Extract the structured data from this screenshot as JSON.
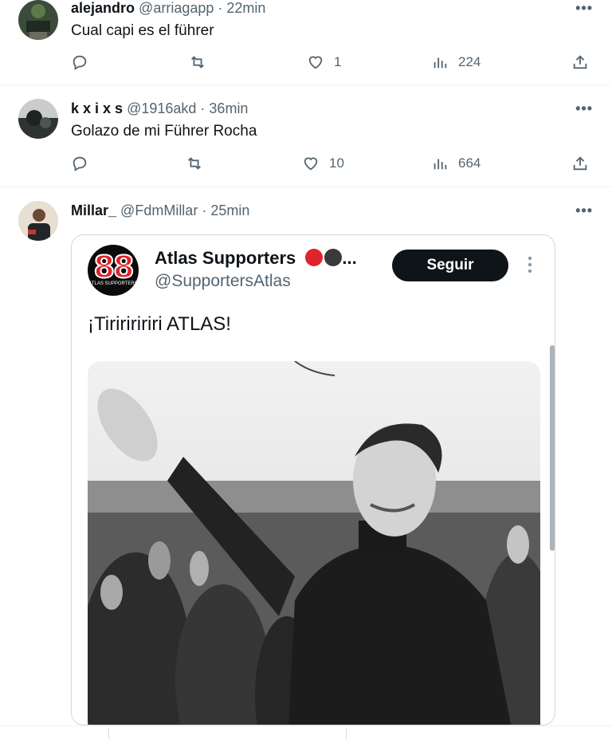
{
  "tweets": [
    {
      "name": "alejandro",
      "handle": "@arriagapp",
      "sep": " · ",
      "time": "22min",
      "text": "Cual capi es el führer",
      "likes": "1",
      "views": "224"
    },
    {
      "name": "k x i x s",
      "handle": "@1916akd",
      "sep": " · ",
      "time": "36min",
      "text": "Golazo de mi Führer Rocha",
      "likes": "10",
      "views": "664"
    },
    {
      "name": "Millar_",
      "handle": "@FdmMillar",
      "sep": " · ",
      "time": "25min"
    }
  ],
  "more_label": "•••",
  "embed": {
    "logo_number": "88",
    "logo_sub": "ATLAS SUPPORTERS",
    "name": "Atlas Supporters",
    "ellipsis": "...",
    "dot_colors": [
      "#e0242b",
      "#3a3a3a"
    ],
    "handle": "@SupportersAtlas",
    "follow_label": "Seguir",
    "kebab": "⋮",
    "text": "¡Tiririririri ATLAS!"
  },
  "icons": {
    "reply": "reply-icon",
    "retweet": "retweet-icon",
    "like": "heart-icon",
    "views": "views-icon",
    "share": "share-icon"
  },
  "colors": {
    "text": "#0f1419",
    "muted": "#536471",
    "border": "#eff3f4",
    "follow_bg": "#0f1419"
  }
}
